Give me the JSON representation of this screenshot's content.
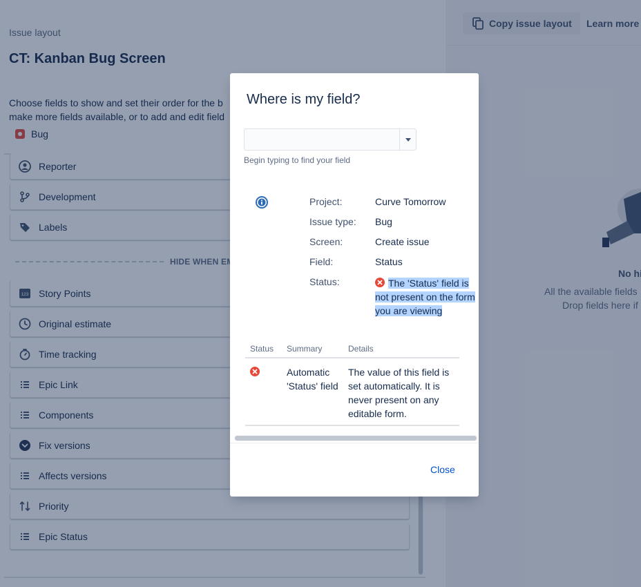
{
  "page": {
    "breadcrumb": "Issue layout",
    "title": "CT: Kanban Bug Screen",
    "description_line1": "Choose fields to show and set their order for the b",
    "description_line2": "make more fields available, or to add and edit field",
    "issue_type": "Bug",
    "hide_when_empty_label": "HIDE WHEN EM",
    "visible_fields": [
      {
        "label": "Reporter",
        "icon": "person-icon"
      },
      {
        "label": "Development",
        "icon": "branch-icon"
      },
      {
        "label": "Labels",
        "icon": "tag-icon"
      }
    ],
    "hidden_fields": [
      {
        "label": "Story Points",
        "icon": "number-icon"
      },
      {
        "label": "Original estimate",
        "icon": "clock-icon"
      },
      {
        "label": "Time tracking",
        "icon": "stopwatch-icon"
      },
      {
        "label": "Epic Link",
        "icon": "list-icon"
      },
      {
        "label": "Components",
        "icon": "list-icon"
      },
      {
        "label": "Fix versions",
        "icon": "chevron-circle-icon"
      },
      {
        "label": "Affects versions",
        "icon": "list-icon"
      },
      {
        "label": "Priority",
        "icon": "priority-icon"
      },
      {
        "label": "Epic Status",
        "icon": "list-icon"
      }
    ]
  },
  "right_panel": {
    "copy_button": "Copy issue layout",
    "learn_more": "Learn more",
    "empty_title": "No hi",
    "empty_line1": "All the available fields",
    "empty_line2": "Drop fields here if"
  },
  "modal": {
    "title": "Where is my field?",
    "select_value": "",
    "select_help": "Begin typing to find your field",
    "info": [
      {
        "key": "Project:",
        "value": "Curve Tomorrow"
      },
      {
        "key": "Issue type:",
        "value": "Bug"
      },
      {
        "key": "Screen:",
        "value": "Create issue"
      },
      {
        "key": "Field:",
        "value": "Status"
      }
    ],
    "status_key": "Status:",
    "status_message": "The 'Status' field is not present on the form you are viewing",
    "table": {
      "headers": [
        "Status",
        "Summary",
        "Details"
      ],
      "row": {
        "summary": "Automatic 'Status' field",
        "details": "The value of this field is set automatically. It is never present on any editable form."
      }
    },
    "close_label": "Close"
  },
  "colors": {
    "accent": "#0052cc",
    "error": "#e5493a",
    "highlight": "#b3d4ff",
    "info": "#0052cc"
  }
}
